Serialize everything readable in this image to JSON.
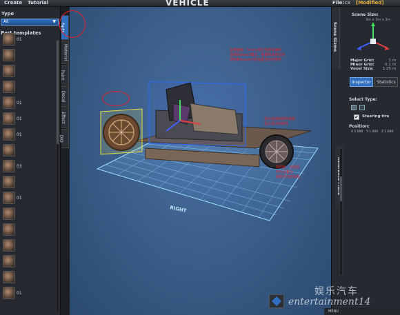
{
  "menu": {
    "create": "Create",
    "tutorial": "Tutorial"
  },
  "app": {
    "title": "VEHICLE"
  },
  "file": {
    "label": "File:",
    "name": "cx",
    "status": "[Modified]"
  },
  "left_panel": {
    "type_label": "Type",
    "type_value": "All",
    "templates_label": "Part templates",
    "parts": [
      {
        "count": "01"
      },
      {
        "count": ""
      },
      {
        "count": ""
      },
      {
        "count": ""
      },
      {
        "count": "01"
      },
      {
        "count": "01"
      },
      {
        "count": "01"
      },
      {
        "count": ""
      },
      {
        "count": "03"
      },
      {
        "count": ""
      },
      {
        "count": "01"
      },
      {
        "count": ""
      },
      {
        "count": ""
      },
      {
        "count": ""
      },
      {
        "count": ""
      },
      {
        "count": ""
      },
      {
        "count": "01"
      }
    ]
  },
  "vertical_tabs": [
    "Parts",
    "Material",
    "Paint",
    "Decal",
    "Effect",
    "DIO"
  ],
  "viewport": {
    "grid_label": "RIGHT",
    "annotation_1": [
      "左侧面板：Scene显示当前车辆的",
      "选择的Select模式，根据所选部位的",
      "材料和Scene分别设置显示的部件"
    ],
    "annotation_2": [
      "显示选择的部件类型",
      "显示选中的部件"
    ],
    "annotation_3": [
      "转向轮：勾选后",
      "可以设置为",
      "控制方向的车轮"
    ]
  },
  "right_panel": {
    "scene_gizmo_tab": "Scene Gizmo",
    "scene_size_label": "Scene Size:",
    "scene_size_value": "3m x 3m x 3m",
    "major_grid_label": "Major Grid:",
    "major_grid_value": "1 m",
    "minor_grid_label": "Minor Grid:",
    "minor_grid_value": "0.1 m",
    "voxel_size_label": "Voxel Size:",
    "voxel_size_value": "1.25 m",
    "tab_inspector": "Inspector",
    "tab_statistics": "Statistics",
    "select_type_label": "Select Type:",
    "steering_label": "Steering tire",
    "steering_checked": "✔",
    "position_label": "Position:",
    "position_x": "X 1.000",
    "position_y": "Y 1.000",
    "position_z": "Z 1.000",
    "reference_plane_tab": "Reference Plane",
    "bottom_text": "MENU"
  },
  "watermark": {
    "cn": "娱乐汽车",
    "en": "entertainment14"
  },
  "colors": {
    "accent": "#2f6fbf",
    "annotation": "#e8202a",
    "viewport_bg": "#3e618f",
    "grid": "#7fd0ff"
  }
}
